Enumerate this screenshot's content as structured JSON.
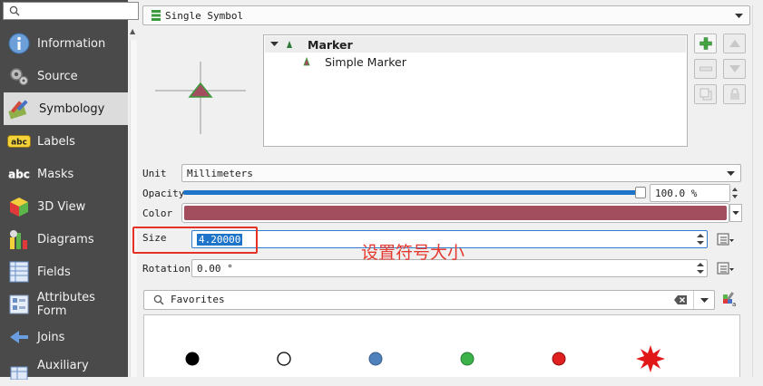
{
  "sidebar": {
    "search_placeholder": "",
    "items": [
      {
        "label": "Information",
        "icon": "information-icon",
        "active": false
      },
      {
        "label": "Source",
        "icon": "source-icon",
        "active": false
      },
      {
        "label": "Symbology",
        "icon": "symbology-icon",
        "active": true
      },
      {
        "label": "Labels",
        "icon": "labels-icon",
        "active": false
      },
      {
        "label": "Masks",
        "icon": "masks-icon",
        "active": false
      },
      {
        "label": "3D View",
        "icon": "3d-view-icon",
        "active": false
      },
      {
        "label": "Diagrams",
        "icon": "diagrams-icon",
        "active": false
      },
      {
        "label": "Fields",
        "icon": "fields-icon",
        "active": false
      },
      {
        "label": "Attributes Form",
        "icon": "attributes-form-icon",
        "active": false
      },
      {
        "label": "Joins",
        "icon": "joins-icon",
        "active": false
      },
      {
        "label": "Auxiliary",
        "icon": "auxiliary-icon",
        "active": false
      }
    ]
  },
  "renderer": {
    "value": "Single Symbol"
  },
  "symbol_tree": {
    "marker_label": "Marker",
    "layer_label": "Simple Marker"
  },
  "unit": {
    "label": "Unit",
    "value": "Millimeters"
  },
  "opacity": {
    "label": "Opacity",
    "value": "100.0 %",
    "level": 1.0
  },
  "color": {
    "label": "Color",
    "value_hex": "#a34e5e"
  },
  "size": {
    "label": "Size",
    "value": "4.20000"
  },
  "rotation": {
    "label": "Rotation",
    "value": "0.00 °"
  },
  "favorites": {
    "value": "Favorites"
  },
  "symbols": [
    {
      "name": "black-dot",
      "color": "#000000"
    },
    {
      "name": "white-dot",
      "color": "#ffffff"
    },
    {
      "name": "blue-dot",
      "color": "#4f81bd"
    },
    {
      "name": "green-dot",
      "color": "#3cb34a"
    },
    {
      "name": "red-dot",
      "color": "#e02020"
    },
    {
      "name": "red-star",
      "color": "#e01818"
    }
  ],
  "annotation": {
    "text": "设置符号大小"
  },
  "colors": {
    "accent": "#1e74c8",
    "sidebar_bg": "#4a4a4a",
    "annotation": "#e53227"
  }
}
